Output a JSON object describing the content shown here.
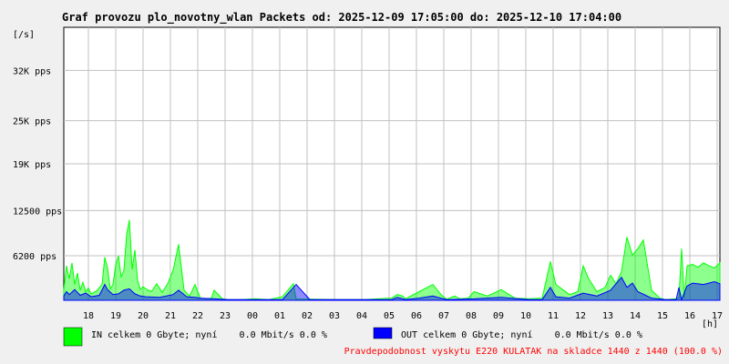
{
  "chart_data": {
    "type": "area",
    "title": "Graf provozu plo_novotny_wlan Packets od: 2025-12-09 17:05:00 do: 2025-12-10 17:04:00",
    "ylabel": "[/s]",
    "xlabel": "[h]",
    "ylim": [
      0,
      38000
    ],
    "grid": true,
    "y_ticks": [
      {
        "value": 6200,
        "label": "6200 pps"
      },
      {
        "value": 12500,
        "label": "12500 pps"
      },
      {
        "value": 19000,
        "label": "19K pps"
      },
      {
        "value": 25000,
        "label": "25K pps"
      },
      {
        "value": 32000,
        "label": "32K pps"
      }
    ],
    "x_ticks": [
      "18",
      "19",
      "20",
      "21",
      "22",
      "23",
      "00",
      "01",
      "02",
      "03",
      "04",
      "05",
      "06",
      "07",
      "08",
      "09",
      "10",
      "11",
      "12",
      "13",
      "14",
      "15",
      "16",
      "17"
    ],
    "x_range_hours": [
      0,
      24
    ],
    "x_tick_first": 0.9,
    "series": [
      {
        "name": "IN",
        "color": "#00ff00",
        "x": [
          0,
          0.1,
          0.2,
          0.3,
          0.4,
          0.5,
          0.6,
          0.7,
          0.8,
          0.9,
          1.0,
          1.2,
          1.4,
          1.5,
          1.6,
          1.7,
          1.8,
          1.9,
          2.0,
          2.1,
          2.2,
          2.3,
          2.4,
          2.5,
          2.6,
          2.7,
          2.8,
          2.9,
          3.0,
          3.2,
          3.4,
          3.6,
          3.8,
          4.0,
          4.2,
          4.4,
          4.6,
          4.8,
          4.9,
          5.0,
          5.2,
          5.4,
          5.5,
          5.8,
          6.0,
          6.5,
          7.0,
          7.5,
          8.0,
          8.4,
          8.5,
          9.0,
          10.0,
          11.0,
          11.5,
          12.0,
          12.2,
          12.4,
          12.5,
          13.0,
          13.5,
          13.8,
          14.0,
          14.3,
          14.5,
          14.8,
          15.0,
          15.5,
          16.0,
          16.5,
          17.0,
          17.5,
          17.8,
          18.0,
          18.5,
          18.8,
          19.0,
          19.2,
          19.5,
          19.8,
          20.0,
          20.2,
          20.4,
          20.6,
          20.8,
          21.0,
          21.2,
          21.5,
          21.8,
          22.0,
          22.4,
          22.5,
          22.6,
          22.7,
          22.8,
          23.0,
          23.2,
          23.4,
          23.6,
          23.8,
          24.0
        ],
        "values": [
          1500,
          4800,
          3000,
          5200,
          2200,
          3800,
          1400,
          2500,
          1200,
          1700,
          900,
          1300,
          2200,
          6000,
          4500,
          1600,
          2200,
          5000,
          6200,
          3200,
          4200,
          9200,
          11200,
          4300,
          7000,
          2800,
          1500,
          1900,
          1600,
          1200,
          2300,
          1100,
          2300,
          4200,
          7800,
          1400,
          600,
          2200,
          1200,
          300,
          200,
          300,
          1400,
          200,
          100,
          100,
          200,
          100,
          500,
          2300,
          150,
          150,
          100,
          100,
          200,
          300,
          800,
          600,
          200,
          1200,
          2200,
          800,
          150,
          600,
          200,
          300,
          1200,
          600,
          1500,
          300,
          200,
          300,
          5400,
          2200,
          800,
          1200,
          4800,
          3000,
          1200,
          1800,
          3500,
          2300,
          4000,
          8800,
          6300,
          7200,
          8400,
          1400,
          300,
          100,
          200,
          300,
          7200,
          300,
          4800,
          5000,
          4600,
          5200,
          4800,
          4500,
          5200
        ]
      },
      {
        "name": "OUT",
        "color": "#0000ff",
        "x": [
          0,
          0.1,
          0.2,
          0.4,
          0.6,
          0.8,
          1.0,
          1.3,
          1.5,
          1.6,
          1.8,
          2.0,
          2.2,
          2.4,
          2.6,
          2.8,
          3.0,
          3.5,
          4.0,
          4.2,
          4.5,
          4.8,
          5.0,
          5.5,
          6.0,
          7.0,
          8.0,
          8.5,
          9.0,
          11.5,
          12.0,
          12.2,
          12.4,
          12.5,
          13.0,
          13.5,
          14.0,
          15.0,
          16.0,
          17.0,
          17.5,
          17.8,
          18.0,
          18.5,
          19.0,
          19.5,
          20.0,
          20.4,
          20.6,
          20.8,
          21.0,
          21.5,
          22.0,
          22.4,
          22.5,
          22.6,
          22.8,
          23.0,
          23.4,
          23.8,
          24.0
        ],
        "values": [
          600,
          1200,
          800,
          1500,
          700,
          1000,
          500,
          700,
          2200,
          1500,
          800,
          900,
          1400,
          1600,
          900,
          600,
          500,
          400,
          800,
          1400,
          500,
          400,
          300,
          200,
          100,
          100,
          100,
          2200,
          100,
          100,
          100,
          400,
          200,
          100,
          300,
          600,
          100,
          200,
          400,
          100,
          100,
          1800,
          500,
          300,
          1000,
          600,
          1400,
          3200,
          1800,
          2400,
          1200,
          300,
          100,
          100,
          1800,
          100,
          2000,
          2400,
          2200,
          2600,
          2300
        ]
      }
    ]
  },
  "legend": {
    "in_text": "IN celkem 0 Gbyte; nyní    0.0 Mbit/s 0.0 %",
    "out_text": "OUT celkem 0 Gbyte; nyní    0.0 Mbit/s 0.0 %",
    "in_color": "#00ff00",
    "out_color": "#0000ff"
  },
  "promo_text": "Pravdepodobnost vyskytu E220 KULATAK na skladce 1440 z 1440 (100.0 %)"
}
